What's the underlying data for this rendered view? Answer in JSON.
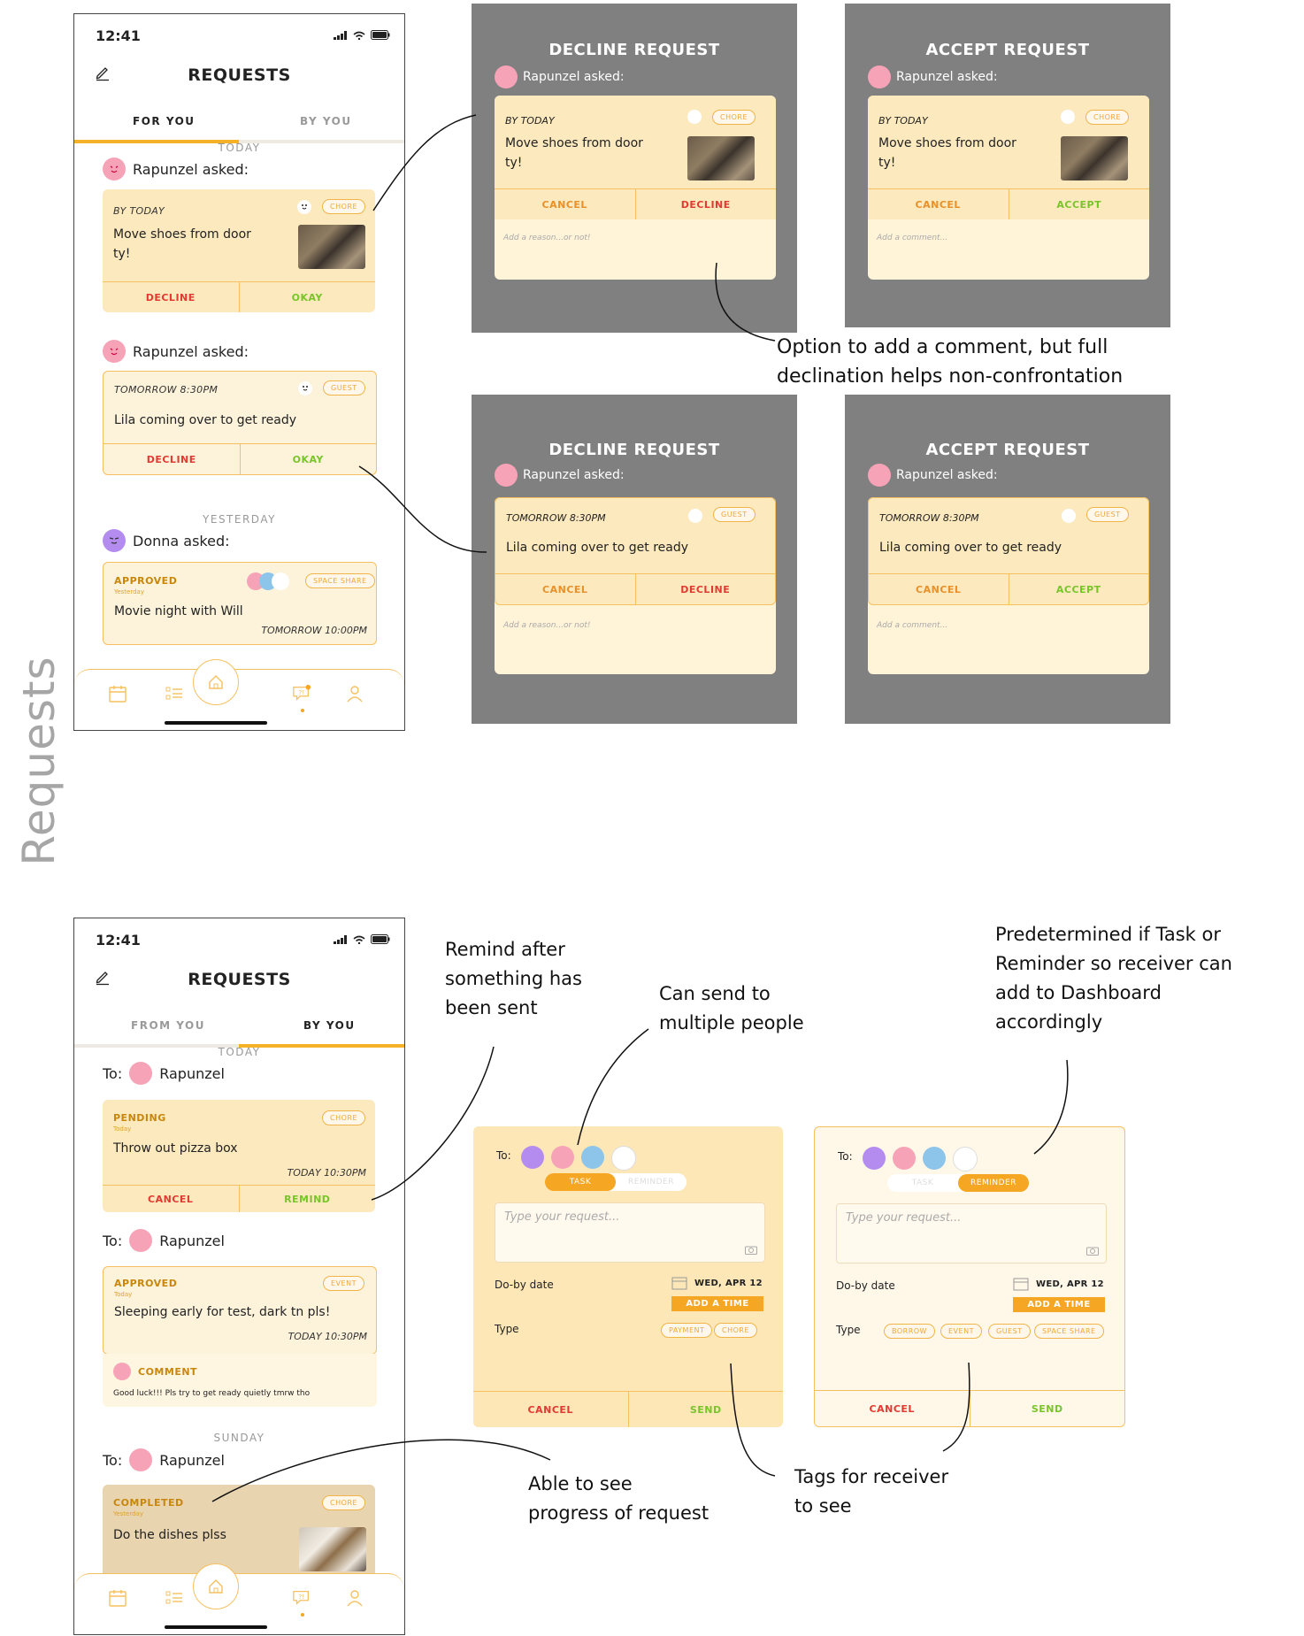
{
  "section_title": "Requests",
  "colors": {
    "accent": "#f5a623",
    "panel_gray": "#808080",
    "decline_red": "#e03a32",
    "okay_green": "#79c42b",
    "card_yellow": "#fce9bd"
  },
  "phone1": {
    "time": "12:41",
    "title": "REQUESTS",
    "tabs": [
      "FOR YOU",
      "BY YOU"
    ],
    "today_label": "TODAY",
    "yesterday_label": "YESTERDAY",
    "req1": {
      "asker": "Rapunzel asked:",
      "due": "BY TODAY",
      "chip": "CHORE",
      "title_l1": "Move shoes from door",
      "title_l2": "ty!",
      "decline": "DECLINE",
      "okay": "OKAY"
    },
    "req2": {
      "asker": "Rapunzel asked:",
      "due": "TOMORROW 8:30PM",
      "chip": "GUEST",
      "title": "Lila coming over to get ready",
      "decline": "DECLINE",
      "okay": "OKAY"
    },
    "req3": {
      "asker": "Donna asked:",
      "status": "APPROVED",
      "status_sub": "Yesterday",
      "chip": "SPACE SHARE",
      "title": "Movie night with Will",
      "when": "TOMORROW 10:00PM"
    }
  },
  "panels": {
    "decline1": {
      "title": "DECLINE REQUEST",
      "asker": "Rapunzel asked:",
      "due": "BY TODAY",
      "chip": "CHORE",
      "title_l1": "Move shoes from door",
      "title_l2": "ty!",
      "cancel": "CANCEL",
      "action": "DECLINE",
      "placeholder": "Add a reason...or not!"
    },
    "accept1": {
      "title": "ACCEPT REQUEST",
      "asker": "Rapunzel asked:",
      "due": "BY TODAY",
      "chip": "CHORE",
      "title_l1": "Move shoes from door",
      "title_l2": "ty!",
      "cancel": "CANCEL",
      "action": "ACCEPT",
      "placeholder": "Add a comment..."
    },
    "decline2": {
      "title": "DECLINE REQUEST",
      "asker": "Rapunzel asked:",
      "due": "TOMORROW 8:30PM",
      "chip": "GUEST",
      "title_l1": "Lila coming over to get ready",
      "cancel": "CANCEL",
      "action": "DECLINE",
      "placeholder": "Add a reason...or not!"
    },
    "accept2": {
      "title": "ACCEPT REQUEST",
      "asker": "Rapunzel asked:",
      "due": "TOMORROW 8:30PM",
      "chip": "GUEST",
      "title_l1": "Lila coming over to get ready",
      "cancel": "CANCEL",
      "action": "ACCEPT",
      "placeholder": "Add a comment..."
    }
  },
  "notes": {
    "comment_option_l1": "Option to add a comment, but full",
    "comment_option_l2": "declination helps non-confrontation",
    "remind_l1": "Remind after",
    "remind_l2": "something has",
    "remind_l3": "been sent",
    "multiple_l1": "Can send to",
    "multiple_l2": "multiple people",
    "predetermined_l1": "Predetermined if Task or",
    "predetermined_l2": "Reminder so receiver can",
    "predetermined_l3": "add to Dashboard",
    "predetermined_l4": "accordingly",
    "progress_l1": "Able to see",
    "progress_l2": "progress of request",
    "tags_l1": "Tags for receiver",
    "tags_l2": "to see"
  },
  "phone2": {
    "time": "12:41",
    "title": "REQUESTS",
    "tabs": [
      "FROM YOU",
      "BY YOU"
    ],
    "today_label": "TODAY",
    "sunday_label": "SUNDAY",
    "to_label": "To:",
    "recipient": "Rapunzel",
    "req1": {
      "status": "PENDING",
      "status_sub": "Today",
      "chip": "CHORE",
      "title": "Throw out pizza box",
      "when": "TODAY 10:30PM",
      "cancel": "CANCEL",
      "remind": "REMIND"
    },
    "req2": {
      "status": "APPROVED",
      "status_sub": "Today",
      "chip": "EVENT",
      "title": "Sleeping early for test, dark tn pls!",
      "when": "TODAY 10:30PM",
      "comment_label": "COMMENT",
      "comment": "Good luck!!! Pls try to get ready quietly tmrw tho"
    },
    "req3": {
      "status": "COMPLETED",
      "status_sub": "Yesterday",
      "chip": "CHORE",
      "title": "Do the dishes plss"
    }
  },
  "form1": {
    "to": "To:",
    "seg": [
      "TASK",
      "REMINDER"
    ],
    "active": "TASK",
    "placeholder": "Type your request...",
    "dob_label": "Do-by date",
    "date": "WED, APR 12",
    "add_time": "ADD A TIME",
    "type_label": "Type",
    "tags": [
      "PAYMENT",
      "CHORE"
    ],
    "cancel": "CANCEL",
    "send": "SEND"
  },
  "form2": {
    "to": "To:",
    "seg": [
      "TASK",
      "REMINDER"
    ],
    "active": "REMINDER",
    "placeholder": "Type your request...",
    "dob_label": "Do-by date",
    "date": "WED, APR 12",
    "add_time": "ADD A TIME",
    "type_label": "Type",
    "tags": [
      "BORROW",
      "EVENT",
      "GUEST",
      "SPACE SHARE"
    ],
    "cancel": "CANCEL",
    "send": "SEND"
  }
}
